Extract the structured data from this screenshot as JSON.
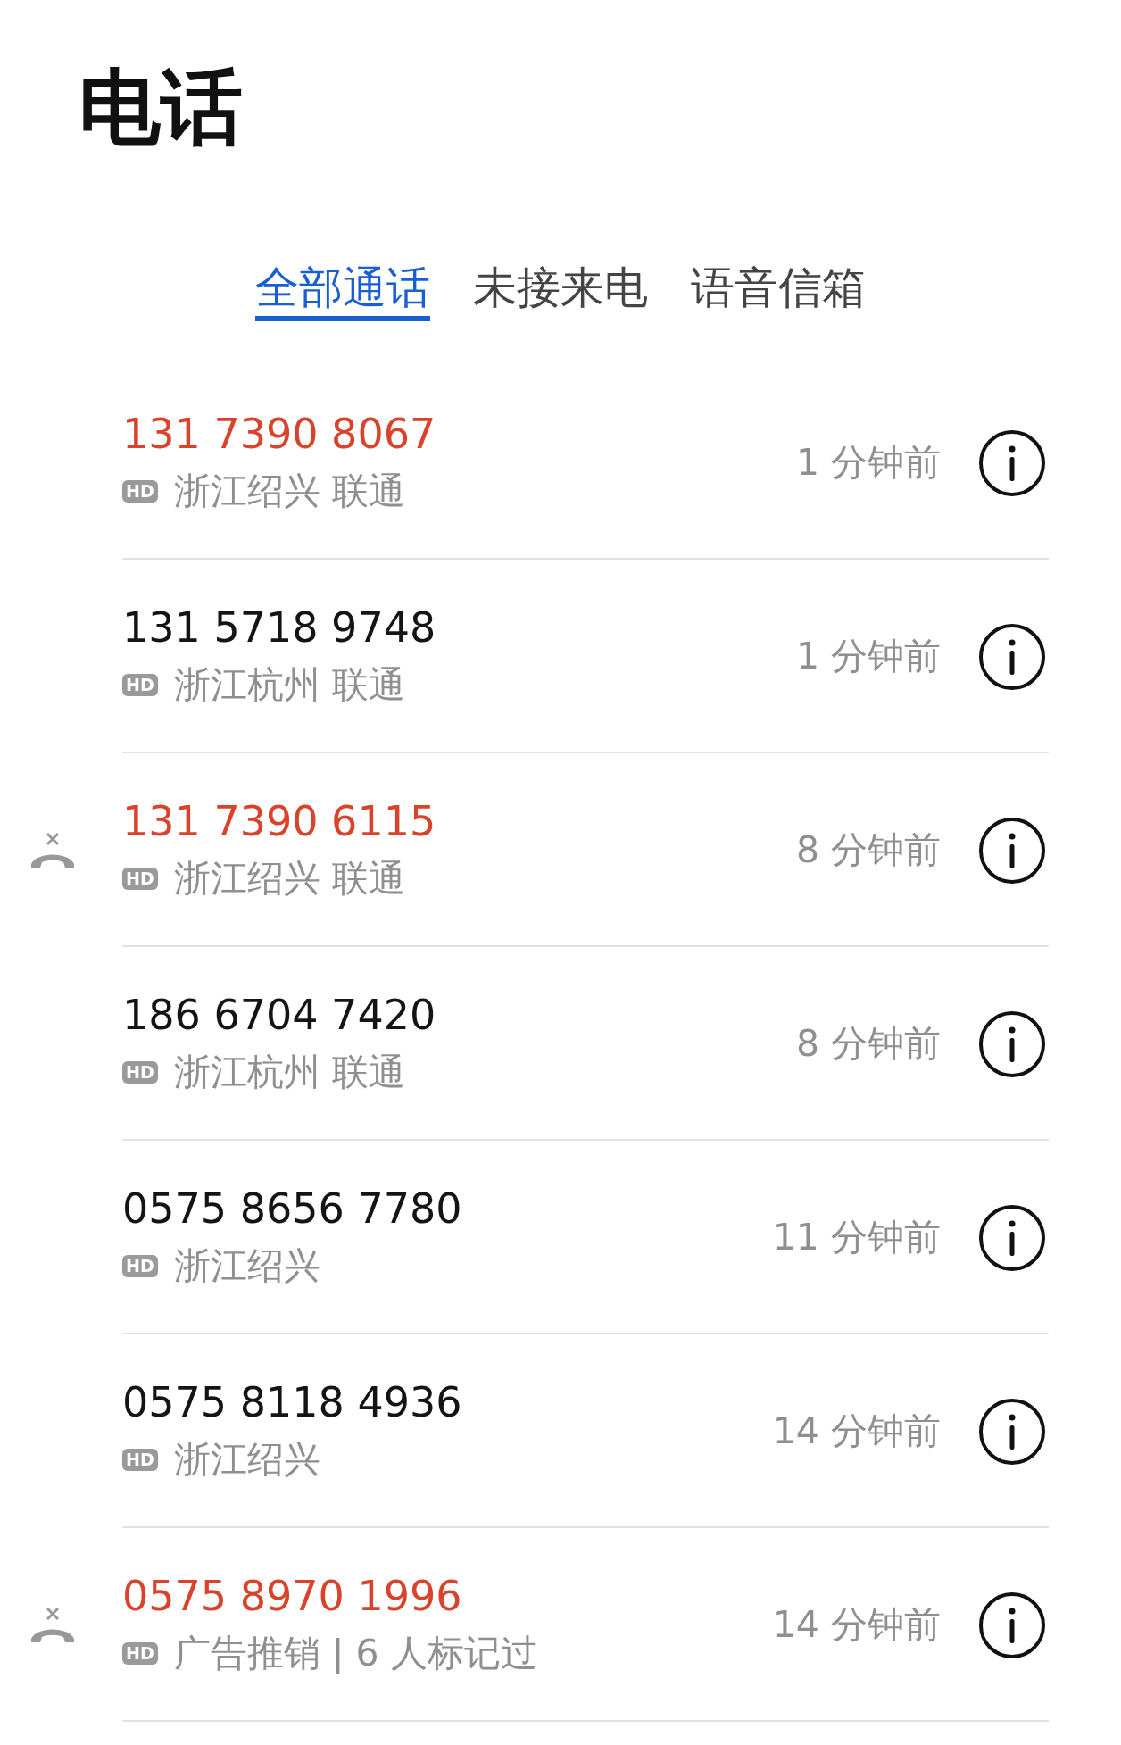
{
  "title": "电话",
  "tabs": [
    {
      "label": "全部通话",
      "selected": true
    },
    {
      "label": "未接来电",
      "selected": false
    },
    {
      "label": "语音信箱",
      "selected": false
    }
  ],
  "calls": [
    {
      "number": "131 7390 8067",
      "missed": true,
      "rejected": false,
      "hd": "HD",
      "location": "浙江绍兴 联通",
      "time": "1 分钟前"
    },
    {
      "number": "131 5718 9748",
      "missed": false,
      "rejected": false,
      "hd": "HD",
      "location": "浙江杭州 联通",
      "time": "1 分钟前"
    },
    {
      "number": "131 7390 6115",
      "missed": true,
      "rejected": true,
      "hd": "HD",
      "location": "浙江绍兴 联通",
      "time": "8 分钟前"
    },
    {
      "number": "186 6704 7420",
      "missed": false,
      "rejected": false,
      "hd": "HD",
      "location": "浙江杭州 联通",
      "time": "8 分钟前"
    },
    {
      "number": "0575 8656 7780",
      "missed": false,
      "rejected": false,
      "hd": "HD",
      "location": "浙江绍兴",
      "time": "11 分钟前"
    },
    {
      "number": "0575 8118 4936",
      "missed": false,
      "rejected": false,
      "hd": "HD",
      "location": "浙江绍兴",
      "time": "14 分钟前"
    },
    {
      "number": "0575 8970 1996",
      "missed": true,
      "rejected": true,
      "hd": "HD",
      "location": "广告推销 | 6 人标记过",
      "time": "14 分钟前"
    }
  ]
}
